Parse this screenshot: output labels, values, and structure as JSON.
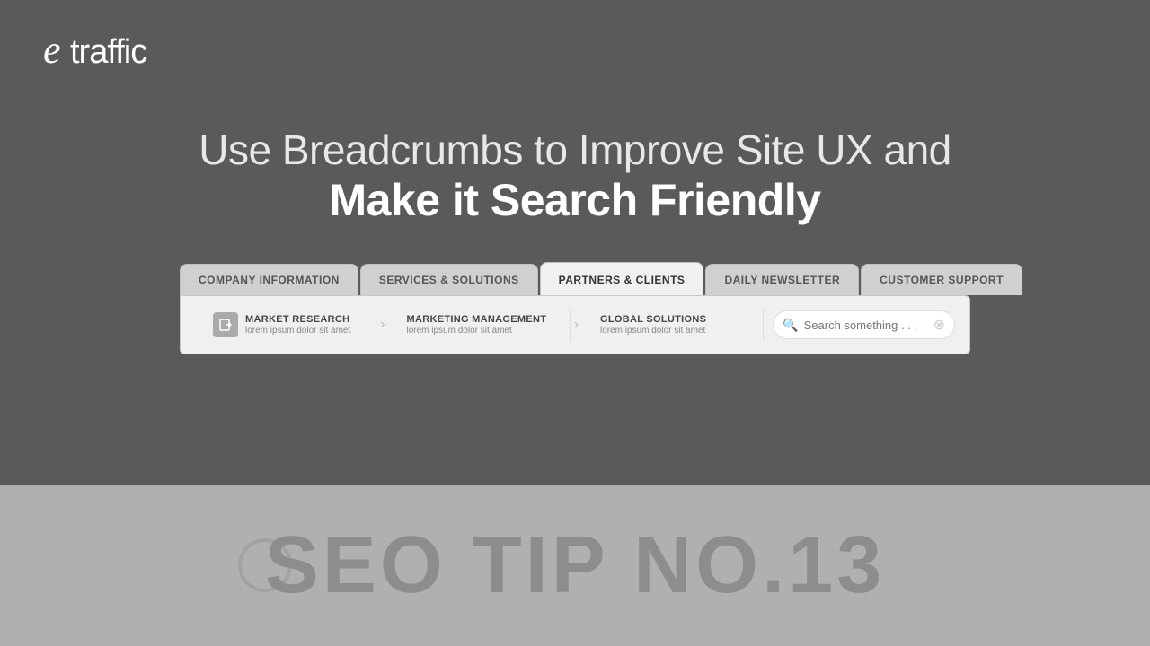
{
  "logo": {
    "text": "etraffic"
  },
  "headline": {
    "line1": "Use Breadcrumbs to Improve Site UX and",
    "line2": "Make it Search Friendly"
  },
  "tabs": [
    {
      "id": "company",
      "label": "COMPANY INFORMATION",
      "active": false
    },
    {
      "id": "services",
      "label": "SERVICES & SOLUTIONS",
      "active": false
    },
    {
      "id": "partners",
      "label": "PARTNERS & CLIENTS",
      "active": true
    },
    {
      "id": "newsletter",
      "label": "DAILY NEWSLETTER",
      "active": false
    },
    {
      "id": "support",
      "label": "CUSTOMER SUPPORT",
      "active": false
    }
  ],
  "breadcrumbs": [
    {
      "id": "market",
      "title": "MARKET RESEARCH",
      "subtitle": "lorem ipsum dolor sit amet",
      "hasIcon": true
    },
    {
      "id": "marketing",
      "title": "MARKETING MANAGEMENT",
      "subtitle": "lorem ipsum dolor sit amet",
      "hasIcon": false
    },
    {
      "id": "global",
      "title": "GLOBAL SOLUTIONS",
      "subtitle": "lorem ipsum dolor sit amet",
      "hasIcon": false
    }
  ],
  "search": {
    "placeholder": "Search something . . ."
  },
  "seo_tip": {
    "text": "SEO TIP NO.13"
  }
}
